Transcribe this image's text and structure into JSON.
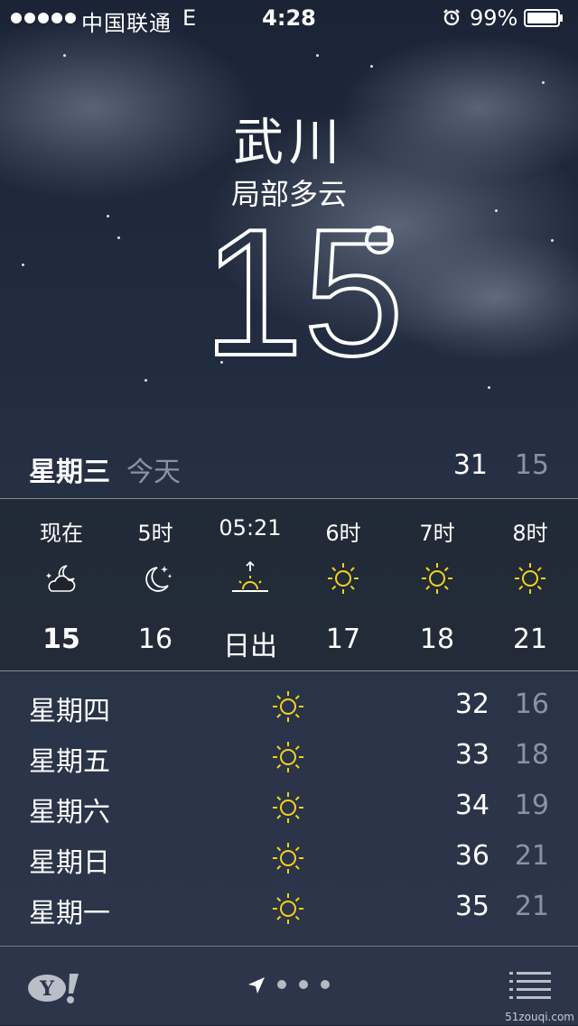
{
  "status_bar": {
    "carrier": "中国联通",
    "network": "E",
    "time": "4:28",
    "battery": "99%",
    "signal_bars": 5,
    "alarm_icon": "alarm-clock-icon",
    "battery_icon": "battery-icon"
  },
  "header": {
    "city": "武川",
    "condition": "局部多云",
    "temperature": "15",
    "degree_symbol": "°"
  },
  "today": {
    "day": "星期三",
    "label": "今天",
    "high": "31",
    "low": "15"
  },
  "hourly": [
    {
      "time": "现在",
      "icon": "partly-cloudy-night-icon",
      "temp": "15"
    },
    {
      "time": "5时",
      "icon": "moon-stars-icon",
      "temp": "16"
    },
    {
      "time": "05:21",
      "icon": "sunrise-icon",
      "temp": "日出"
    },
    {
      "time": "6时",
      "icon": "sun-icon",
      "temp": "17"
    },
    {
      "time": "7时",
      "icon": "sun-icon",
      "temp": "18"
    },
    {
      "time": "8时",
      "icon": "sun-icon",
      "temp": "21"
    }
  ],
  "daily": [
    {
      "day": "星期四",
      "icon": "sun-icon",
      "high": "32",
      "low": "16"
    },
    {
      "day": "星期五",
      "icon": "sun-icon",
      "high": "33",
      "low": "18"
    },
    {
      "day": "星期六",
      "icon": "sun-icon",
      "high": "34",
      "low": "19"
    },
    {
      "day": "星期日",
      "icon": "sun-icon",
      "high": "36",
      "low": "21"
    },
    {
      "day": "星期一",
      "icon": "sun-icon",
      "high": "35",
      "low": "21"
    }
  ],
  "footer": {
    "logo": "yahoo-logo",
    "page_dots": 3,
    "location_icon": "location-arrow-icon",
    "menu_icon": "list-icon"
  },
  "watermark": "51zouqi.com",
  "colors": {
    "sun": "#f4d21a",
    "secondary_text": "#8b93a3"
  }
}
